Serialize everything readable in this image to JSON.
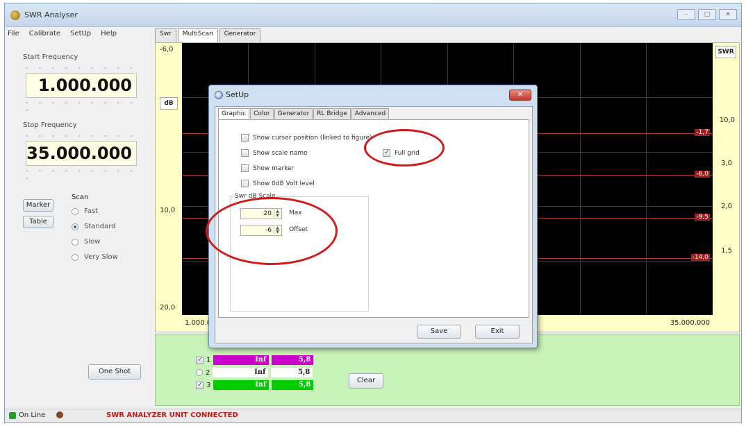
{
  "app": {
    "title": "SWR Analyser",
    "window_buttons": [
      "–",
      "□",
      "✕"
    ]
  },
  "menu": [
    "File",
    "Calibrate",
    "SetUp",
    "Help"
  ],
  "left": {
    "start_label": "Start Frequency",
    "start_value": "1.000.000",
    "stop_label": "Stop Frequency",
    "stop_value": "35.000.000",
    "dots": "- - - - - - - - - -",
    "marker_btn": "Marker",
    "table_btn": "Table",
    "scan_title": "Scan",
    "scan_options": [
      {
        "label": "Fast",
        "selected": false
      },
      {
        "label": "Standard",
        "selected": true
      },
      {
        "label": "Slow",
        "selected": false
      },
      {
        "label": "Very Slow",
        "selected": false
      }
    ],
    "one_shot_btn": "One Shot"
  },
  "main_tabs": [
    {
      "label": "Swr",
      "active": false
    },
    {
      "label": "MultiScan",
      "active": true
    },
    {
      "label": "Generator",
      "active": false
    }
  ],
  "chart": {
    "db_axis_top": "-6,0",
    "db_axis_mid": "10,0",
    "db_axis_bottom": "20,0",
    "db_header": "dB",
    "swr_header": "SWR",
    "swr_axis": [
      "10,0",
      "3,0",
      "2,0",
      "1,5"
    ],
    "marker_labels": [
      "-1,7",
      "-6,0",
      "-9,5",
      "-14,0"
    ],
    "x_start": "1.000.0",
    "x_end": "35.000.000",
    "colors": {
      "plot_bg": "#000000",
      "frame_bg": "#ffffc8",
      "marker_line": "#b23a3a"
    }
  },
  "legend": [
    {
      "id": "1",
      "swr": "Inf",
      "val": "5,8",
      "color": "#cc00cc"
    },
    {
      "id": "2",
      "swr": "Inf",
      "val": "5,8",
      "color": "#ffffff"
    },
    {
      "id": "3",
      "swr": "Inf",
      "val": "5,8",
      "color": "#00cc00"
    }
  ],
  "clear_btn": "Clear",
  "status": {
    "online": "On Line",
    "message": "SWR ANALYZER UNIT CONNECTED"
  },
  "dialog": {
    "title": "SetUp",
    "tabs": [
      "Graphic",
      "Color",
      "Generator",
      "RL Bridge",
      "Advanced"
    ],
    "options": [
      {
        "label": "Show cursor position (linked to figure)",
        "checked": false
      },
      {
        "label": "Show scale name",
        "checked": false
      },
      {
        "label": "Show marker",
        "checked": false
      },
      {
        "label": "Show 0dB Volt level",
        "checked": false
      }
    ],
    "full_grid": {
      "label": "Full grid",
      "checked": true
    },
    "group_title": "Swr dB Scale",
    "max_value": "20",
    "max_label": "Max",
    "offset_value": "-6",
    "offset_label": "Offset",
    "save_btn": "Save",
    "exit_btn": "Exit",
    "close_btn": "✕"
  }
}
